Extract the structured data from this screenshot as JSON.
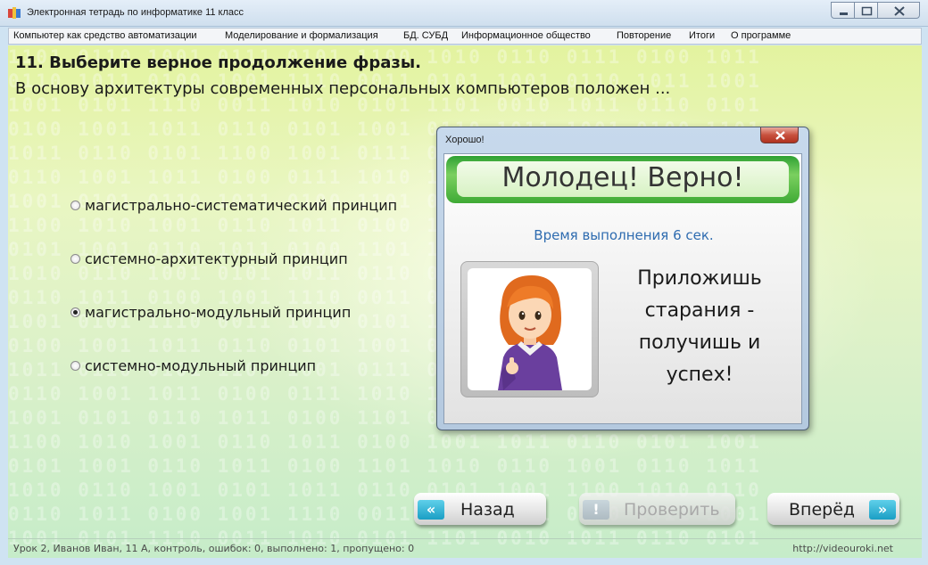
{
  "window": {
    "title": "Электронная тетрадь по информатике 11 класс"
  },
  "menu": {
    "items": [
      "Компьютер как средство автоматизации",
      "Моделирование и формализация",
      "БД. СУБД",
      "Информационное общество",
      "Повторение",
      "Итоги",
      "О программе"
    ]
  },
  "question": {
    "title": "11. Выберите верное продолжение фразы.",
    "text": "В основу архитектуры современных персональных компьютеров положен ...",
    "options": [
      {
        "label": "магистрально-систематический принцип",
        "selected": false
      },
      {
        "label": "системно-архитектурный принцип",
        "selected": false
      },
      {
        "label": "магистрально-модульный принцип",
        "selected": true
      },
      {
        "label": "системно-модульный принцип",
        "selected": false
      }
    ]
  },
  "nav": {
    "back_label": "Назад",
    "back_icon": "«",
    "check_label": "Проверить",
    "check_icon": "!",
    "forward_label": "Вперёд",
    "forward_icon": "»"
  },
  "status": {
    "left": "Урок 2, Иванов Иван, 11 А, контроль, ошибок: 0, выполнено: 1, пропущено: 0",
    "right": "http://videouroki.net"
  },
  "dialog": {
    "title": "Хорошо!",
    "banner": "Молодец! Верно!",
    "time": "Время выполнения 6 сек.",
    "motto": "Приложишь старания - получишь и успех!"
  },
  "colors": {
    "accent_blue": "#2f6cb0",
    "banner_green": "#3faa35",
    "nav_badge": "#1a9ec4"
  }
}
